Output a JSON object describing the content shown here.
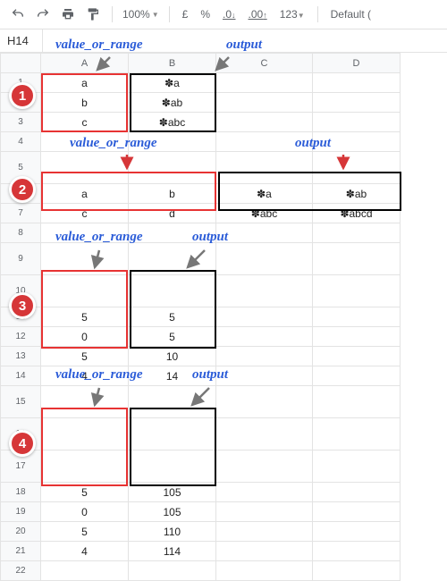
{
  "toolbar": {
    "zoom": "100%",
    "currency": "£",
    "percent": "%",
    "dec_dec": ".0",
    "inc_dec": ".00",
    "num_fmt": "123",
    "font": "Default ("
  },
  "namebox": "H14",
  "cols": [
    "A",
    "B",
    "C",
    "D"
  ],
  "rows": [
    "1",
    "2",
    "3",
    "4",
    "5",
    "6",
    "7",
    "8",
    "9",
    "10",
    "11",
    "12",
    "13",
    "14",
    "15",
    "16",
    "17",
    "18",
    "19",
    "20",
    "21",
    "22"
  ],
  "cells": {
    "A1": "a",
    "B1": "✽a",
    "A2": "b",
    "B2": "✽ab",
    "A3": "c",
    "B3": "✽abc",
    "A6": "a",
    "B6": "b",
    "C6": "✽a",
    "D6": "✽ab",
    "A7": "c",
    "B7": "d",
    "C7": "✽abc",
    "D7": "✽abcd",
    "A11": "5",
    "B11": "5",
    "A12": "0",
    "B12": "5",
    "A13": "5",
    "B13": "10",
    "A14": "4",
    "B14": "14",
    "A18": "5",
    "B18": "105",
    "A19": "0",
    "B19": "105",
    "A20": "5",
    "B20": "110",
    "A21": "4",
    "B21": "114"
  },
  "labels": {
    "vor": "value_or_range",
    "out": "output"
  },
  "badges": [
    "1",
    "2",
    "3",
    "4"
  ]
}
